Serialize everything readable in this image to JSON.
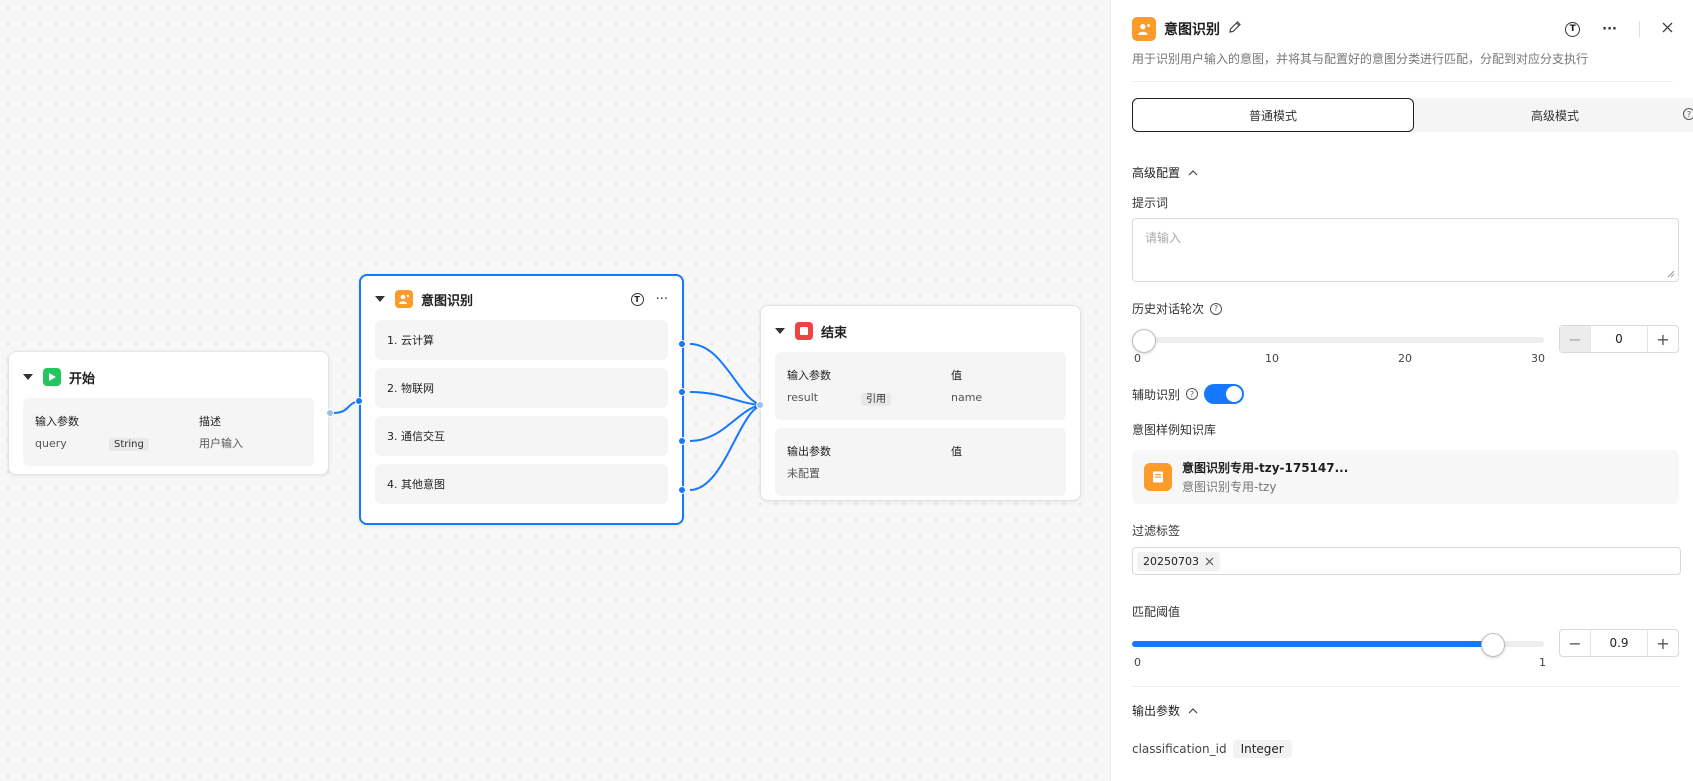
{
  "canvas": {
    "start_node": {
      "title": "开始",
      "header": {
        "param": "输入参数",
        "desc": "描述"
      },
      "rows": [
        {
          "name": "query",
          "type": "String",
          "desc": "用户输入"
        }
      ]
    },
    "intent_node": {
      "title": "意图识别",
      "intents": [
        "1. 云计算",
        "2. 物联网",
        "3. 通信交互",
        "4. 其他意图"
      ]
    },
    "end_node": {
      "title": "结束",
      "input_header": {
        "param": "输入参数",
        "value": "值"
      },
      "input_rows": [
        {
          "name": "result",
          "type": "引用",
          "value": "name"
        }
      ],
      "output_header": {
        "param": "输出参数",
        "value": "值"
      },
      "output_empty": "未配置"
    }
  },
  "panel": {
    "title": "意图识别",
    "description": "用于识别用户输入的意图，并将其与配置好的意图分类进行匹配，分配到对应分支执行",
    "modes": [
      "普通模式",
      "高级模式"
    ],
    "active_mode": "普通模式",
    "advanced_config": {
      "title": "高级配置",
      "prompt_label": "提示词",
      "prompt_placeholder": "请输入",
      "history_label": "历史对话轮次",
      "history_value": "0",
      "history_ticks": [
        "0",
        "10",
        "20",
        "30"
      ],
      "assist_label": "辅助识别",
      "assist_enabled": true,
      "kb_label": "意图样例知识库",
      "kb_name": "意图识别专用-tzy-175147...",
      "kb_sub": "意图识别专用-tzy",
      "filter_label": "过滤标签",
      "filter_tags": [
        "20250703"
      ],
      "threshold_label": "匹配阈值",
      "threshold_value": "0.9",
      "threshold_ticks": [
        "0",
        "1"
      ]
    },
    "output": {
      "title": "输出参数",
      "param_name": "classification_id",
      "param_type": "Integer"
    }
  },
  "colors": {
    "accent": "#1677ff",
    "start": "#22c55e",
    "intent": "#fa9b2c",
    "end": "#ef4444"
  }
}
